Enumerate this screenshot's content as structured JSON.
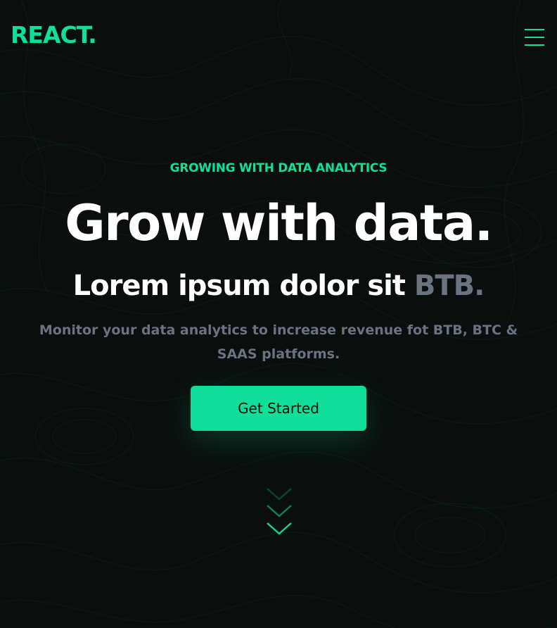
{
  "brand": {
    "logo": "REACT."
  },
  "nav": {
    "menu_icon": "hamburger-menu-icon"
  },
  "hero": {
    "eyebrow": "GROWING WITH DATA ANALYTICS",
    "headline": "Grow with data.",
    "subheadline_main": "Lorem ipsum dolor sit",
    "subheadline_accent": "BTB.",
    "description": "Monitor your data analytics to increase revenue fot BTB, BTC & SAAS platforms.",
    "cta_label": "Get Started",
    "scroll_icon": "chevron-down-icon"
  },
  "theme": {
    "background": "#0a0f0d",
    "accent": "#0fdf9a",
    "muted": "#6b7280",
    "heading": "#ffffff"
  }
}
